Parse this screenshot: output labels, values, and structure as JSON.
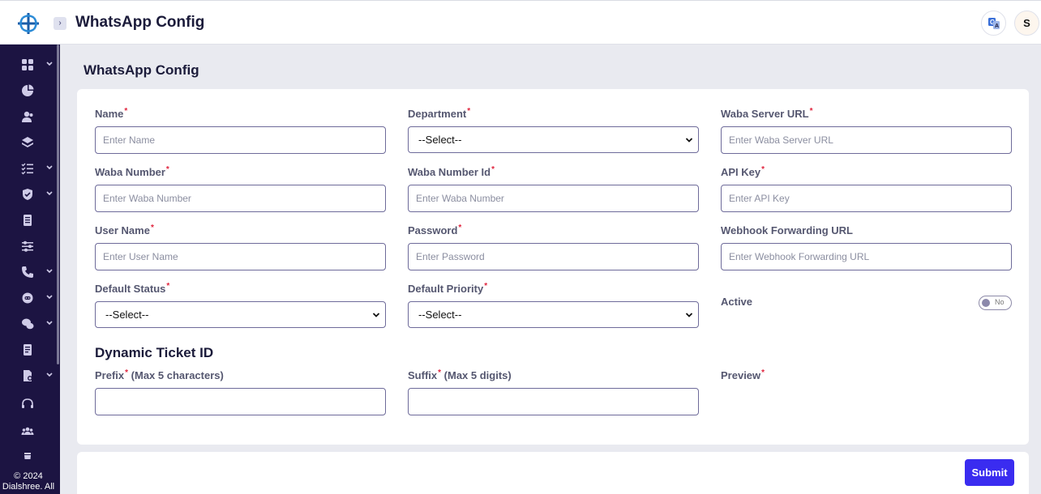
{
  "header": {
    "title": "WhatsApp Config",
    "avatar_initial": "S",
    "icons": [
      "app-logo",
      "sidebar-toggle-icon",
      "translate-icon"
    ]
  },
  "sidebar": {
    "items": [
      {
        "icon": "dashboard-grid-icon",
        "has_submenu": true
      },
      {
        "icon": "pie-chart-icon",
        "has_submenu": false
      },
      {
        "icon": "users-icon",
        "has_submenu": false
      },
      {
        "icon": "layers-icon",
        "has_submenu": false
      },
      {
        "icon": "task-list-icon",
        "has_submenu": true
      },
      {
        "icon": "shield-check-icon",
        "has_submenu": true
      },
      {
        "icon": "document-icon",
        "has_submenu": false
      },
      {
        "icon": "sliders-icon",
        "has_submenu": false
      },
      {
        "icon": "phone-call-icon",
        "has_submenu": true
      },
      {
        "icon": "bot-icon",
        "has_submenu": true
      },
      {
        "icon": "chat-icon",
        "has_submenu": true
      },
      {
        "icon": "report-icon",
        "has_submenu": false
      },
      {
        "icon": "file-settings-icon",
        "has_submenu": true
      },
      {
        "icon": "headset-icon",
        "has_submenu": false
      },
      {
        "icon": "team-icon",
        "has_submenu": false
      },
      {
        "icon": "trash-icon",
        "has_submenu": false
      }
    ],
    "copyright_line1": "© 2024",
    "copyright_line2": "Dialshree. All"
  },
  "form": {
    "section_title": "WhatsApp Config",
    "name": {
      "label": "Name",
      "placeholder": "Enter Name"
    },
    "department": {
      "label": "Department",
      "selected": "--Select--"
    },
    "waba_server_url": {
      "label": "Waba Server URL",
      "placeholder": "Enter Waba Server URL"
    },
    "waba_number": {
      "label": "Waba Number",
      "placeholder": "Enter Waba Number"
    },
    "waba_number_id": {
      "label": "Waba Number Id",
      "placeholder": "Enter Waba Number"
    },
    "api_key": {
      "label": "API Key",
      "placeholder": "Enter API Key"
    },
    "user_name": {
      "label": "User Name",
      "placeholder": "Enter User Name"
    },
    "password": {
      "label": "Password",
      "placeholder": "Enter Password"
    },
    "webhook_url": {
      "label": "Webhook Forwarding URL",
      "placeholder": "Enter Webhook Forwarding URL"
    },
    "default_status": {
      "label": "Default Status",
      "selected": "--Select--"
    },
    "default_priority": {
      "label": "Default Priority",
      "selected": "--Select--"
    },
    "active": {
      "label": "Active",
      "toggle_text": "No",
      "on": false
    },
    "required_mark": "*",
    "dynamic_ticket": {
      "title": "Dynamic Ticket ID",
      "prefix_label": "Prefix",
      "prefix_note": "(Max 5 characters)",
      "suffix_label": "Suffix",
      "suffix_note": "(Max 5 digits)",
      "preview_label": "Preview"
    },
    "submit_label": "Submit"
  },
  "colors": {
    "sidebar_bg": "#1c1442",
    "accent": "#3a2cf0",
    "required": "#e0243d"
  }
}
